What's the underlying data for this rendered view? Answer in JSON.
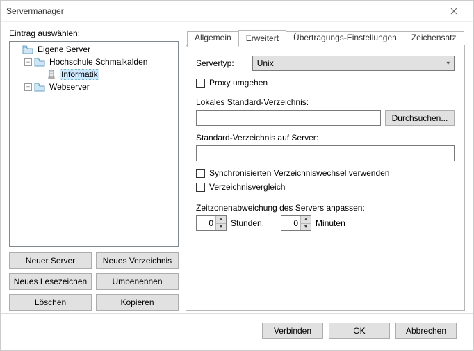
{
  "window": {
    "title": "Servermanager"
  },
  "left": {
    "label": "Eintrag auswählen:",
    "tree": {
      "root": "Eigene Server",
      "items": [
        {
          "label": "Hochschule Schmalkalden",
          "expanded": true,
          "children": [
            {
              "label": "Informatik",
              "selected": true
            }
          ]
        },
        {
          "label": "Webserver",
          "expanded": false
        }
      ]
    },
    "buttons": {
      "new_server": "Neuer Server",
      "new_dir": "Neues Verzeichnis",
      "new_bookmark": "Neues Lesezeichen",
      "rename": "Umbenennen",
      "delete": "Löschen",
      "copy": "Kopieren"
    }
  },
  "tabs": {
    "general": "Allgemein",
    "advanced": "Erweitert",
    "transfer": "Übertragungs-Einstellungen",
    "charset": "Zeichensatz"
  },
  "panel": {
    "servertype_label": "Servertyp:",
    "servertype_value": "Unix",
    "proxy_bypass": "Proxy umgehen",
    "local_dir_label": "Lokales Standard-Verzeichnis:",
    "local_dir_value": "",
    "browse": "Durchsuchen...",
    "remote_dir_label": "Standard-Verzeichnis auf Server:",
    "remote_dir_value": "",
    "sync_browse": "Synchronisierten Verzeichniswechsel verwenden",
    "dir_compare": "Verzeichnisvergleich",
    "tz_label": "Zeitzonenabweichung des Servers anpassen:",
    "hours_value": "0",
    "hours_label": "Stunden,",
    "minutes_value": "0",
    "minutes_label": "Minuten"
  },
  "footer": {
    "connect": "Verbinden",
    "ok": "OK",
    "cancel": "Abbrechen"
  }
}
